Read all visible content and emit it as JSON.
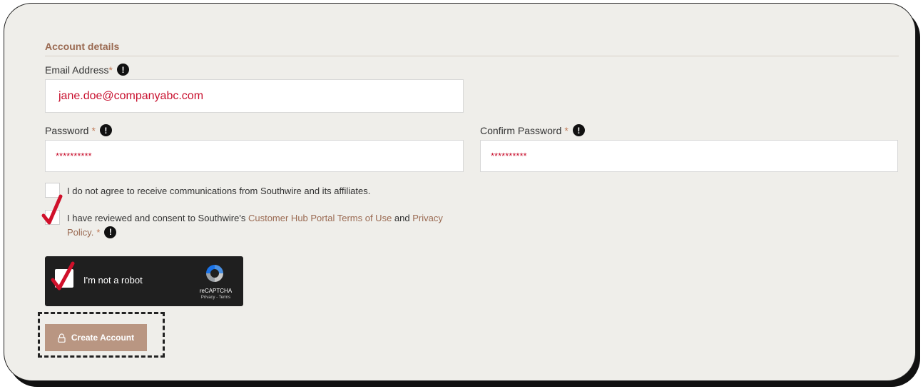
{
  "section": {
    "title": "Account details"
  },
  "email": {
    "label": "Email Address",
    "required_mark": "*",
    "value": "jane.doe@companyabc.com"
  },
  "password": {
    "label": "Password",
    "required_mark": "*",
    "value": "**********"
  },
  "confirm_password": {
    "label": "Confirm Password",
    "required_mark": "*",
    "value": "**********"
  },
  "communications_checkbox": {
    "text": "I do not agree to receive communications from Southwire and its affiliates.",
    "checked": false
  },
  "terms_checkbox": {
    "text_prefix": "I have reviewed and consent to Southwire's ",
    "terms_link": "Customer Hub Portal Terms of Use",
    "and_text": " and ",
    "privacy_link_line1": "Privacy",
    "privacy_link_line2": "Policy.",
    "required_mark": "*",
    "checked": true
  },
  "recaptcha": {
    "label": "I'm not a robot",
    "brand": "reCAPTCHA",
    "links": "Privacy - Terms",
    "checked": true
  },
  "create_button": {
    "label": "Create Account",
    "icon": "lock-icon"
  },
  "info_icon_glyph": "!",
  "colors": {
    "accent": "#9a6a52",
    "button": "#b99682",
    "error_text": "#c8102e",
    "check_red": "#d0102a"
  }
}
